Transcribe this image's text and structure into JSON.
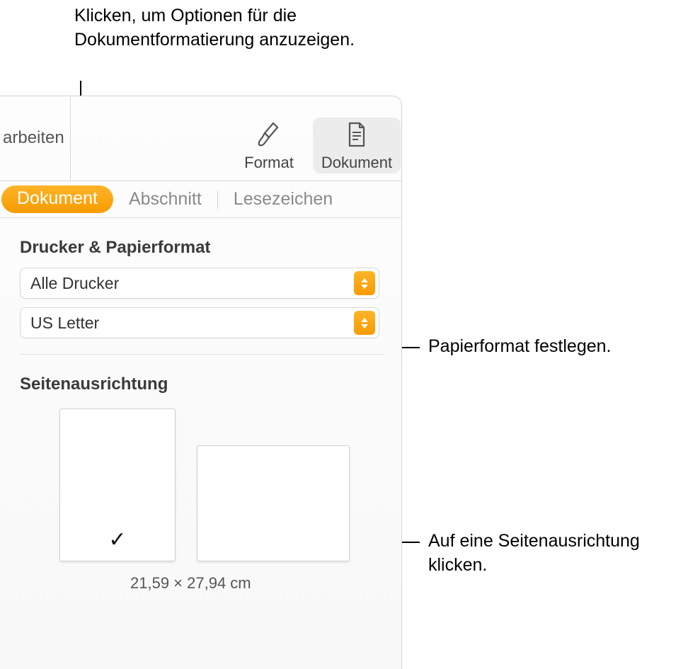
{
  "callouts": {
    "top": "Klicken, um Optionen für die Dokumentformatierung anzuzeigen.",
    "paper": "Papierformat festlegen.",
    "orient": "Auf eine Seitenausrichtung klicken."
  },
  "toolbar": {
    "left_fragment": "arbeiten",
    "format_label": "Format",
    "document_label": "Dokument"
  },
  "subtabs": {
    "document": "Dokument",
    "section": "Abschnitt",
    "bookmarks": "Lesezeichen"
  },
  "section_printer": {
    "title": "Drucker & Papierformat",
    "printer_value": "Alle Drucker",
    "paper_value": "US Letter"
  },
  "section_orient": {
    "title": "Seitenausrichtung",
    "checkmark": "✓",
    "dimensions": "21,59 × 27,94 cm"
  }
}
